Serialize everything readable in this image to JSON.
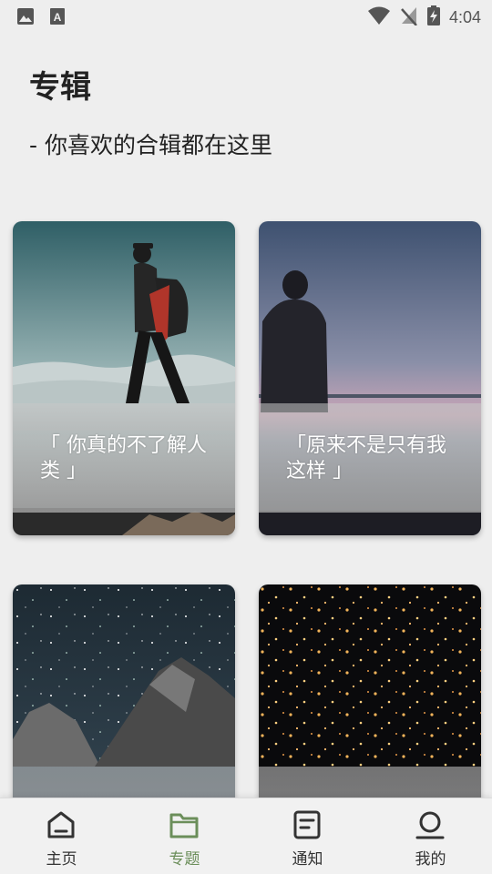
{
  "status_bar": {
    "time": "4:04",
    "left_icons": [
      "image-icon",
      "a-text-icon"
    ],
    "right_icons": [
      "wifi-icon",
      "no-signal-icon",
      "battery-charging-icon"
    ]
  },
  "header": {
    "title": "专辑",
    "subtitle": "- 你喜欢的合辑都在这里"
  },
  "albums": [
    {
      "caption": "「 你真的不了解人类 」",
      "scene": "hiker-mountains"
    },
    {
      "caption": "「原来不是只有我这样 」",
      "scene": "man-by-lake"
    },
    {
      "caption": "",
      "scene": "starry-rocks"
    },
    {
      "caption": "",
      "scene": "sky-lanterns"
    }
  ],
  "bottom_nav": {
    "items": [
      {
        "label": "主页",
        "icon": "home-icon",
        "active": false
      },
      {
        "label": "专题",
        "icon": "folder-icon",
        "active": true
      },
      {
        "label": "通知",
        "icon": "document-icon",
        "active": false
      },
      {
        "label": "我的",
        "icon": "user-icon",
        "active": false
      }
    ],
    "active_color": "#6b8e5a",
    "inactive_color": "#333333"
  }
}
